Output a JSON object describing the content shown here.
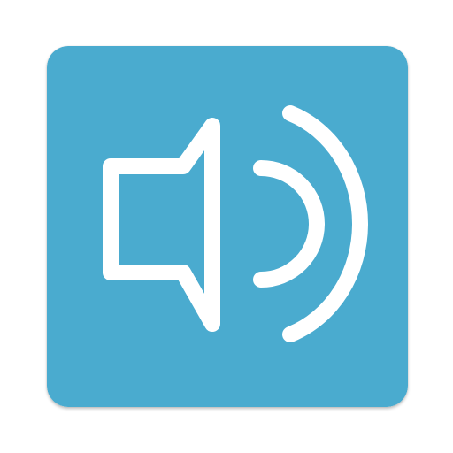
{
  "app_icon": {
    "icon_name": "speaker-volume-icon",
    "background_color": "#4aabcf",
    "glyph_color": "#ffffff"
  }
}
